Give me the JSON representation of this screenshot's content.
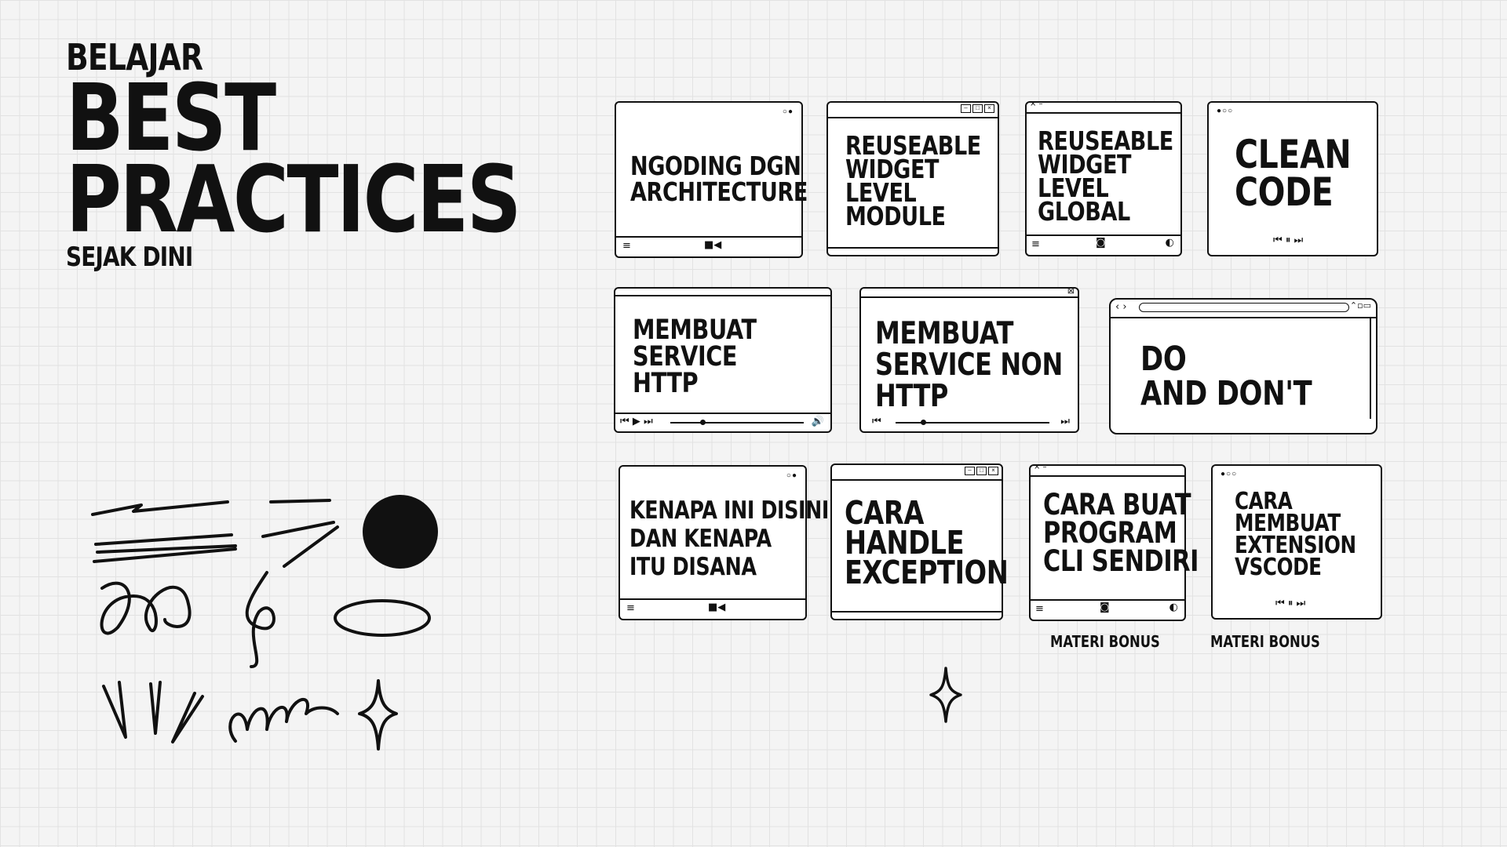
{
  "header": {
    "line1": "BELAJAR",
    "line2": "BEST",
    "line3": "PRACTICES",
    "line4": "SEJAK DINI"
  },
  "cards": [
    {
      "text": "NGODING DGN\nARCHITECTURE"
    },
    {
      "text": "REUSEABLE\nWIDGET\nLEVEL\nMODULE"
    },
    {
      "text": "REUSEABLE\nWIDGET\nLEVEL\nGLOBAL"
    },
    {
      "text": "CLEAN\nCODE"
    },
    {
      "text": "MEMBUAT\nSERVICE\nHTTP"
    },
    {
      "text": "MEMBUAT\nSERVICE NON\nHTTP"
    },
    {
      "text": "DO\nAND DON'T"
    },
    {
      "text": "KENAPA INI DISINI\nDAN KENAPA\nITU DISANA"
    },
    {
      "text": "CARA\nHANDLE\nEXCEPTION"
    },
    {
      "text": "CARA BUAT\nPROGRAM\nCLI SENDIRI"
    },
    {
      "text": "CARA\nMEMBUAT\nEXTENSION\nVSCODE"
    }
  ],
  "bonus_labels": [
    "MATERI BONUS",
    "MATERI BONUS"
  ],
  "icons": [
    "hamburger-icon",
    "video-camera-icon",
    "camera-icon",
    "toggle-icon",
    "play-icon",
    "pause-icon",
    "skip-back-icon",
    "skip-forward-icon",
    "volume-icon",
    "close-icon",
    "sparkle-icon"
  ]
}
